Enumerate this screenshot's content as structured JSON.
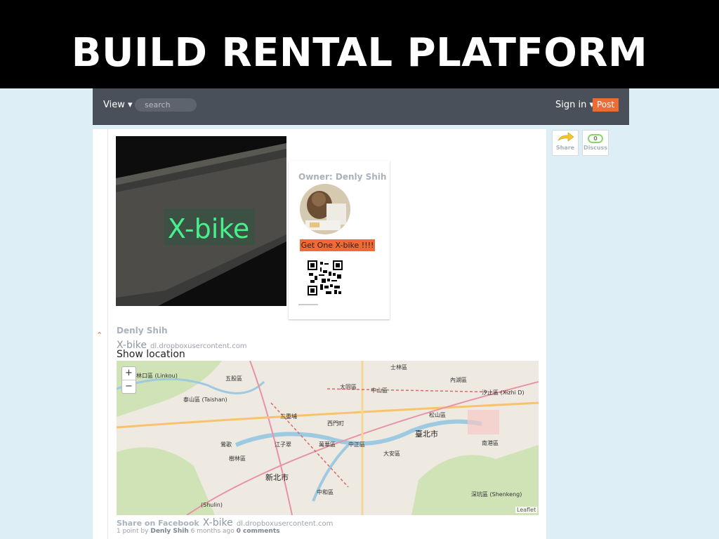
{
  "slide": {
    "title": "BUILD RENTAL PLATFORM"
  },
  "navbar": {
    "view_label": "View ▾",
    "search_placeholder": "search",
    "signin_label": "Sign in ▾",
    "post_label": "Post"
  },
  "post": {
    "image_text": "X-bike",
    "owner_label": "Owner: Denly Shih",
    "cta_label": "Get One X-bike !!!!",
    "author": "Denly Shih",
    "title": "X-bike",
    "domain": "dl.dropboxusercontent.com",
    "show_location": "Show location",
    "share_fb_label": "Share on Facebook",
    "points": "1 point",
    "by_word": "by",
    "age": "6 months ago",
    "comments": "0 comments"
  },
  "side_actions": {
    "share_label": "Share",
    "discuss_label": "Discuss",
    "discuss_count": "0"
  },
  "map": {
    "zoom_in": "+",
    "zoom_out": "−",
    "attribution": "Leaflet",
    "labels": [
      "林口區 (Linkou)",
      "泰山區 (Taishan)",
      "五股區",
      "大同區",
      "中山區",
      "內湖區",
      "汐止區 (Xizhi D)",
      "松山區",
      "西門町",
      "臺北市",
      "南港區",
      "萬華區",
      "中正區",
      "大安區",
      "江子翠",
      "新北市",
      "中和區",
      "深坑區 (Shenkeng)",
      "(Shulin)",
      "鶯歌",
      "三重埔",
      "士林區",
      "樹林區"
    ]
  },
  "colors": {
    "accent": "#f06a34",
    "navbar": "#4a5059",
    "page_bg": "#ddeef6"
  }
}
